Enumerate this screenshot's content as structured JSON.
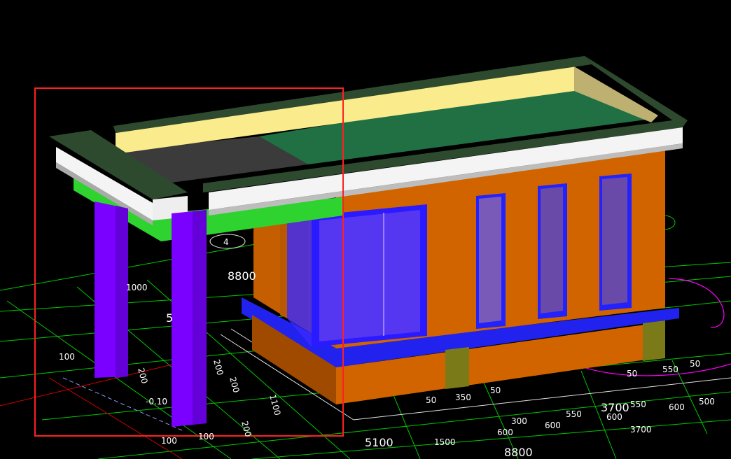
{
  "viewport": {
    "title": "",
    "background": "#000000"
  },
  "colors": {
    "grid_line": "#00c800",
    "axis_red": "#d00000",
    "magenta": "#ff00ff",
    "selection_red": "#ff2020",
    "wall_orange": "#d26400",
    "wall_dark": "#a04a00",
    "column_purple": "#7a00ff",
    "slab_green": "#2fd32f",
    "roof_dark_green": "#2e4a2e",
    "roof_fill_green": "#217044",
    "roof_parapet_yellow": "#faeb8c",
    "cornice_white": "#f4f4f4",
    "window_blue": "#2020ff",
    "window_glass": "#6a40d0",
    "footing_olive": "#7a7a18",
    "roof_dark_gray": "#3b3b3b"
  },
  "dims": {
    "d_8800_top": "8800",
    "d_5100": "5100",
    "d_8800_bottom": "8800",
    "d_3700_a": "3700",
    "d_3700_b": "3700",
    "d_1500": "1500",
    "d_600_a": "600",
    "d_600_b": "600",
    "d_600_c": "600",
    "d_600_d": "600",
    "d_550_a": "550",
    "d_550_b": "550",
    "d_550_c": "550",
    "d_500_a": "500",
    "d_350": "350",
    "d_300": "300",
    "d_50_a": "50",
    "d_50_b": "50",
    "d_50_c": "50",
    "d_50_d": "50",
    "d_100_a": "100",
    "d_100_b": "100",
    "d_100_c": "100",
    "d_200_a": "200",
    "d_200_b": "200",
    "d_200_c": "200",
    "d_200_d": "200",
    "d_1100": "1100",
    "d_5_left": "5",
    "d_m010": "-0.10",
    "d_4_circle": "4",
    "d_1000": "1000"
  }
}
